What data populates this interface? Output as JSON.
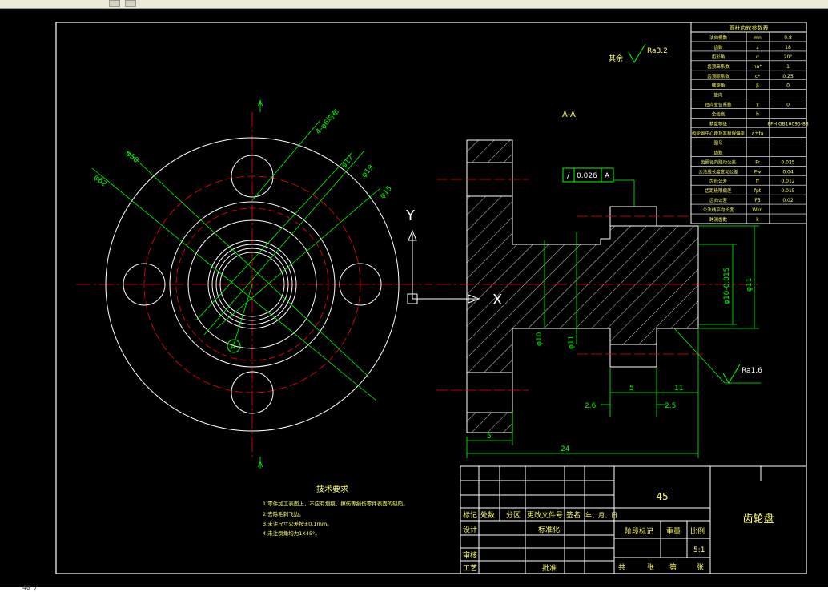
{
  "toolbar": {
    "icons": [
      "pencil-icon",
      "cube-icon"
    ]
  },
  "status": {
    "coord_text": "40 /"
  },
  "colors": {
    "frame": "#ffffff",
    "dimension": "#00ff00",
    "center": "#ff0000",
    "hatch": "#ffffff",
    "text_yellow": "#ffff66"
  },
  "drawing": {
    "section_label": "A-A",
    "section_mark_top": "A",
    "section_mark_bottom": "A",
    "datum_label": "A",
    "roughness_rest_label": "其余",
    "roughness_rest_value": "Ra3.2",
    "roughness_value2": "Ra1.6",
    "tolerance_symbol": "/",
    "tolerance_value": "0.026",
    "tolerance_datum": "A",
    "ucs_y": "Y",
    "ucs_x": "X",
    "dims_front": [
      "φ62",
      "φ50",
      "4-φ6均布",
      "φ42",
      "φ17",
      "φ19",
      "φ15"
    ],
    "dims_section": {
      "d1": "φ10",
      "d2": "φ11",
      "d3": "φ10-0.015",
      "d4": "φ11",
      "len5": "5",
      "len11": "11",
      "len26": "2.6",
      "len25": "2.5",
      "len5b": "5",
      "len24": "24"
    }
  },
  "params_table": {
    "title": "圆柱齿轮参数表",
    "rows": [
      {
        "name": "法向模数",
        "sym": "mn",
        "val": "0.8"
      },
      {
        "name": "齿数",
        "sym": "z",
        "val": "18"
      },
      {
        "name": "齿形角",
        "sym": "α",
        "val": "20°"
      },
      {
        "name": "齿顶高系数",
        "sym": "ha*",
        "val": "1"
      },
      {
        "name": "齿顶隙系数",
        "sym": "c*",
        "val": "0.25"
      },
      {
        "name": "螺旋角",
        "sym": "β",
        "val": "0"
      },
      {
        "name": "旋向",
        "sym": "",
        "val": ""
      },
      {
        "name": "径向变位系数",
        "sym": "x",
        "val": "0"
      },
      {
        "name": "全齿高",
        "sym": "h",
        "val": ""
      },
      {
        "name": "精度等级",
        "sym": "",
        "val": "8FH GB10095-88"
      },
      {
        "name": "齿轮副中心距及其极限偏差",
        "sym": "a±fa",
        "val": ""
      },
      {
        "name": "图号",
        "sym": "",
        "val": ""
      },
      {
        "name": "齿数",
        "sym": "",
        "val": ""
      },
      {
        "name": "齿圈径向跳动公差",
        "sym": "Fr",
        "val": "0.025"
      },
      {
        "name": "公法线长度变动公差",
        "sym": "Fw",
        "val": "0.04"
      },
      {
        "name": "齿形公差",
        "sym": "ff",
        "val": "0.012"
      },
      {
        "name": "齿距极限偏差",
        "sym": "fpt",
        "val": "0.015"
      },
      {
        "name": "齿向公差",
        "sym": "Fβ",
        "val": "0.02"
      },
      {
        "name": "公法线平均长度",
        "sym": "Wkn",
        "val": ""
      },
      {
        "name": "跨测齿数",
        "sym": "k",
        "val": ""
      }
    ],
    "group_mating": "配对齿轮",
    "group_tolerance": "公差组",
    "group_length": "公法线"
  },
  "tech_req": {
    "title": "技术要求",
    "lines": [
      "1.零件加工表面上，不应有划痕、擦伤等损伤零件表面的缺陷。",
      "2.去除毛刺飞边。",
      "3.未注尺寸公差按±0.1mm。",
      "4.未注倒角均为1X45°。"
    ]
  },
  "title_block": {
    "material": "45",
    "part_name": "齿轮盘",
    "h_mark": "标记",
    "h_count": "处数",
    "h_zone": "分区",
    "h_docno": "更改文件号",
    "h_sign": "签名",
    "h_date": "年、月、日",
    "design": "设计",
    "standard": "标准化",
    "stage": "阶段标记",
    "weight": "重量",
    "scale_label": "比例",
    "scale": "5:1",
    "review": "审核",
    "process": "工艺",
    "approve": "批准",
    "total": "共",
    "sheets": "张",
    "page": "第",
    "page2": "张"
  }
}
